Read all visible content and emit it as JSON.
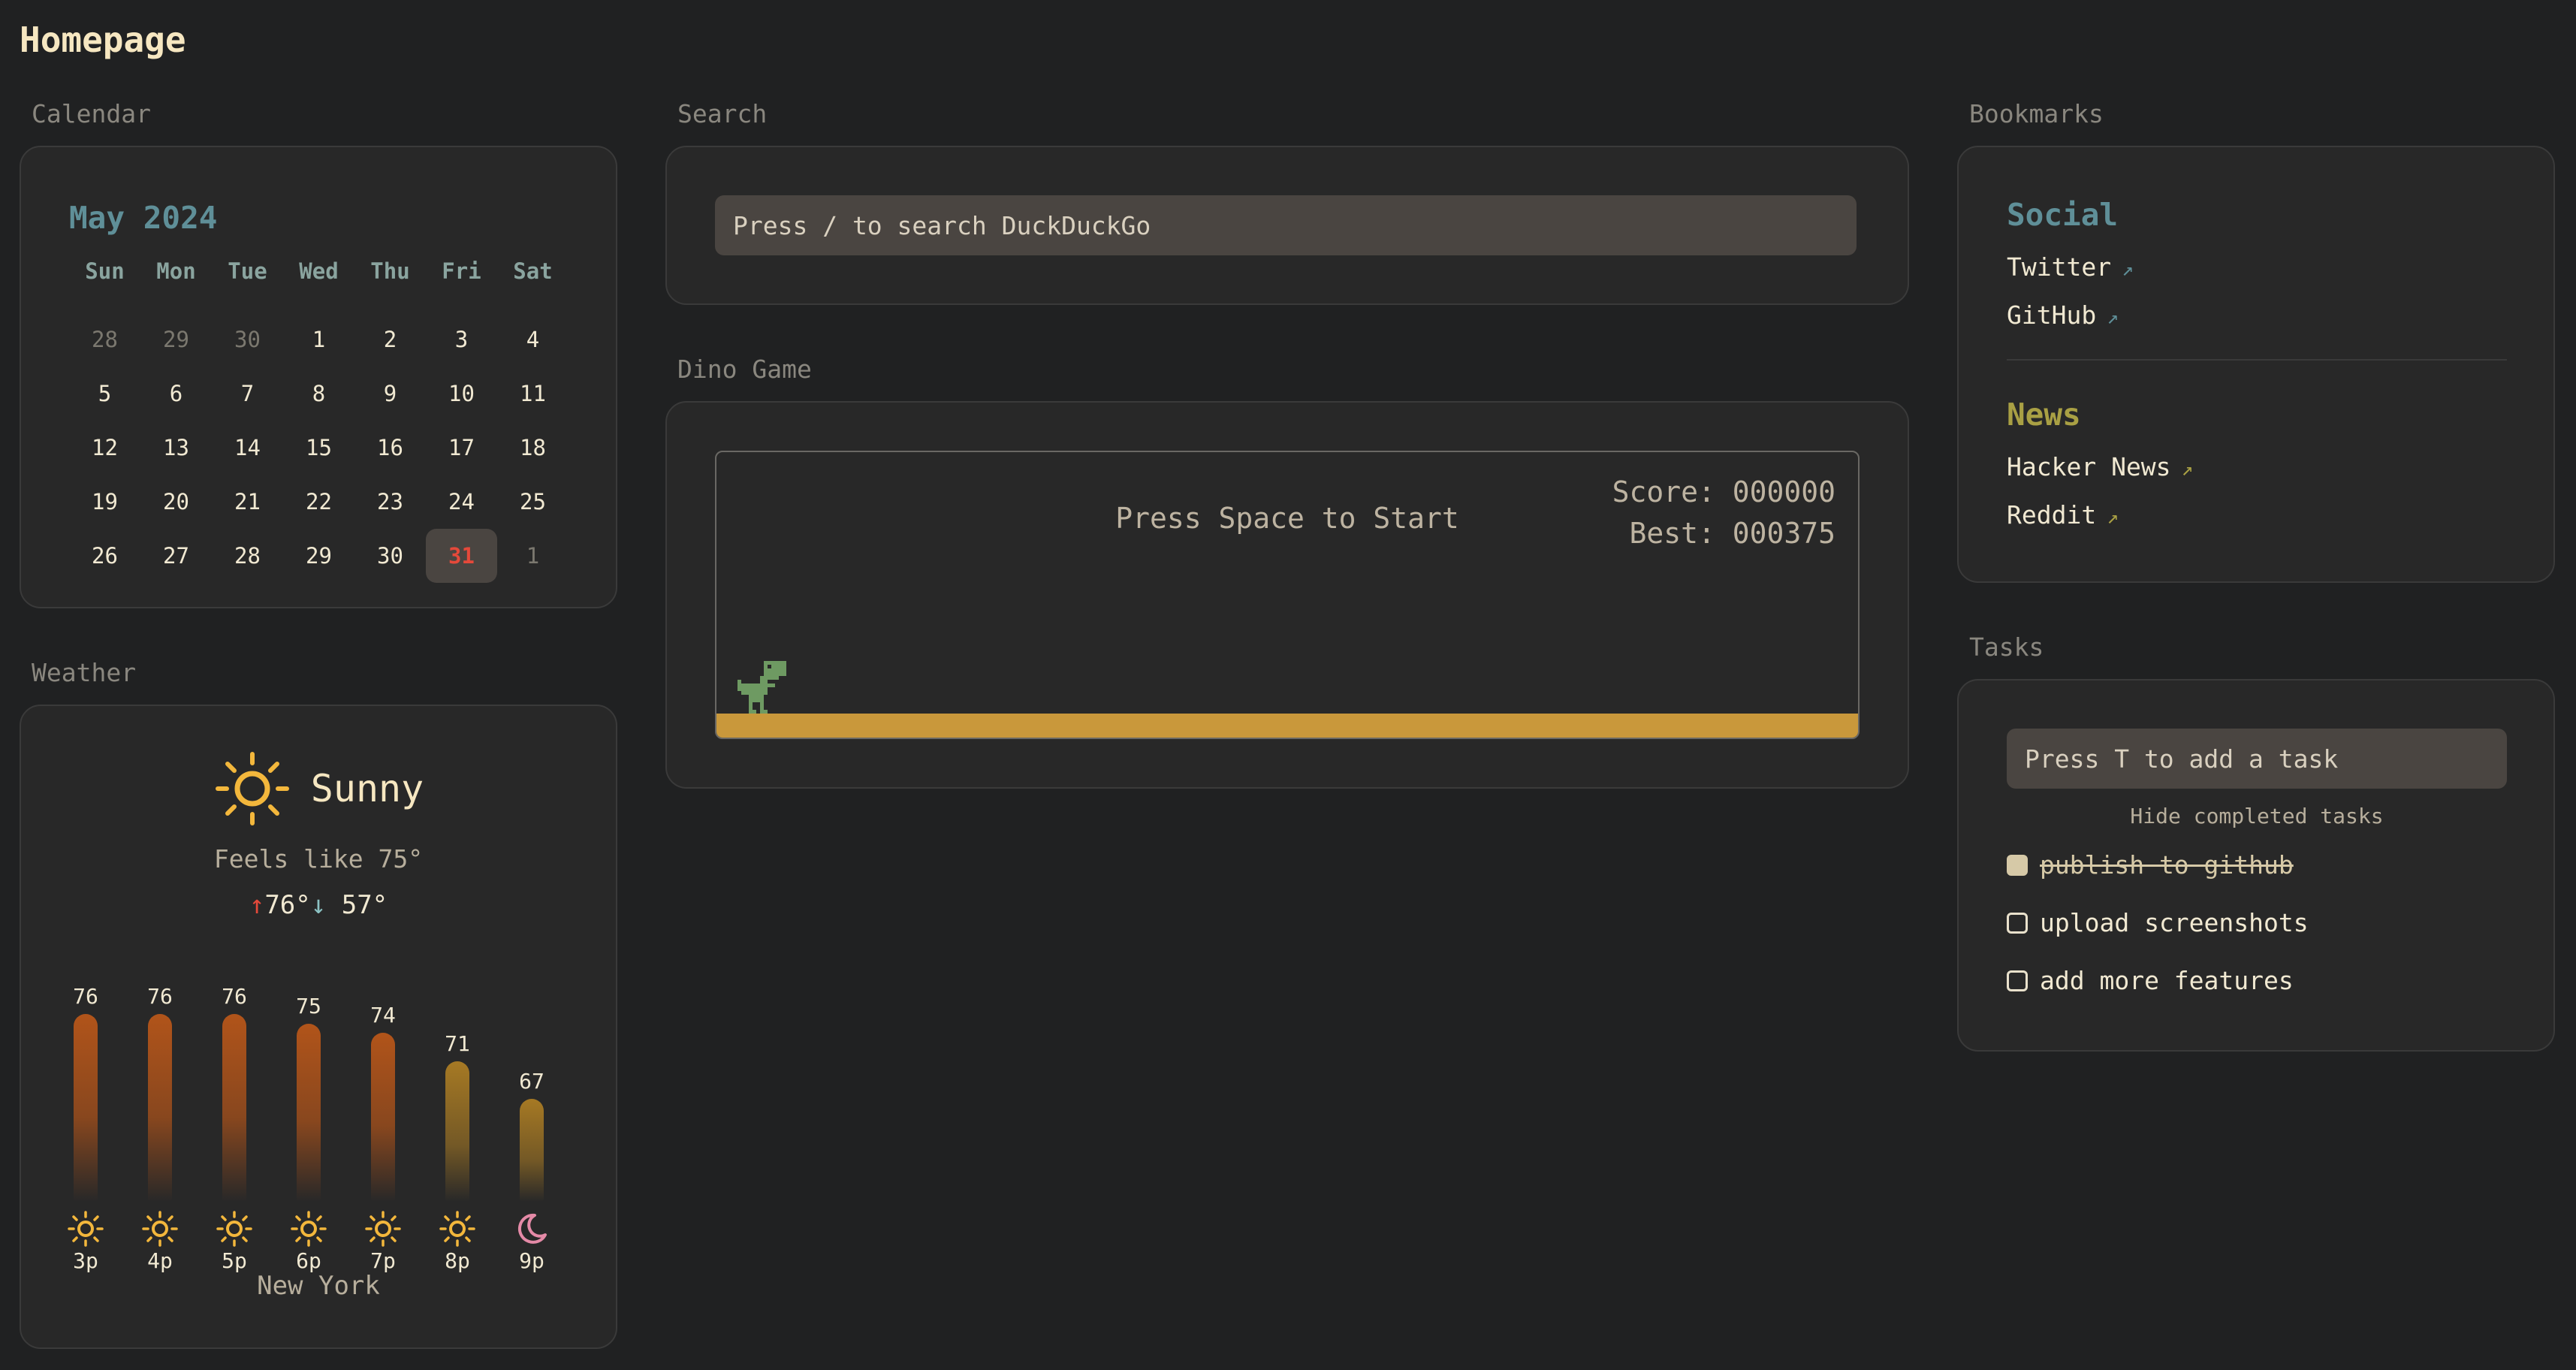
{
  "page": {
    "title": "Homepage"
  },
  "calendar": {
    "label": "Calendar",
    "month": "May 2024",
    "days_of_week": [
      "Sun",
      "Mon",
      "Tue",
      "Wed",
      "Thu",
      "Fri",
      "Sat"
    ],
    "weeks": [
      [
        "28",
        "29",
        "30",
        "1",
        "2",
        "3",
        "4"
      ],
      [
        "5",
        "6",
        "7",
        "8",
        "9",
        "10",
        "11"
      ],
      [
        "12",
        "13",
        "14",
        "15",
        "16",
        "17",
        "18"
      ],
      [
        "19",
        "20",
        "21",
        "22",
        "23",
        "24",
        "25"
      ],
      [
        "26",
        "27",
        "28",
        "29",
        "30",
        "31",
        "1"
      ]
    ],
    "today": "31"
  },
  "weather": {
    "label": "Weather",
    "condition": "Sunny",
    "condition_icon": "sun-icon",
    "feels_like": "Feels like 75°",
    "high_arrow": "↑",
    "high": "76°",
    "low_arrow": "↓",
    "low": "57°",
    "city": "New York",
    "hourly": [
      {
        "time": "3p",
        "temp": 76,
        "icon": "sun-icon"
      },
      {
        "time": "4p",
        "temp": 76,
        "icon": "sun-icon"
      },
      {
        "time": "5p",
        "temp": 76,
        "icon": "sun-icon"
      },
      {
        "time": "6p",
        "temp": 75,
        "icon": "sun-icon"
      },
      {
        "time": "7p",
        "temp": 74,
        "icon": "sun-icon"
      },
      {
        "time": "8p",
        "temp": 71,
        "icon": "sun-icon"
      },
      {
        "time": "9p",
        "temp": 67,
        "icon": "moon-icon"
      }
    ]
  },
  "search": {
    "label": "Search",
    "placeholder": "Press / to search DuckDuckGo"
  },
  "dino": {
    "label": "Dino Game",
    "start_text": "Press Space to Start",
    "score": "Score: 000000",
    "best": "Best: 000375"
  },
  "bookmarks": {
    "label": "Bookmarks",
    "groups": [
      {
        "title": "Social",
        "links": [
          "Twitter",
          "GitHub"
        ]
      },
      {
        "title": "News",
        "links": [
          "Hacker News",
          "Reddit"
        ]
      }
    ],
    "arrow": "↗"
  },
  "tasks": {
    "label": "Tasks",
    "placeholder": "Press T to add a task",
    "hide_completed": "Hide completed tasks",
    "items": [
      {
        "text": "publish to github",
        "done": true
      },
      {
        "text": "upload screenshots",
        "done": false
      },
      {
        "text": "add more features",
        "done": false
      }
    ]
  },
  "colors": {
    "background": "#202122",
    "card": "#282828",
    "social_accent": "#5f8f98",
    "news_accent": "#a9a044",
    "today": "#e5493a",
    "bar": "#b1541a",
    "ground": "#c9983b",
    "sun": "#f3b73c",
    "moon": "#e58aa7"
  }
}
